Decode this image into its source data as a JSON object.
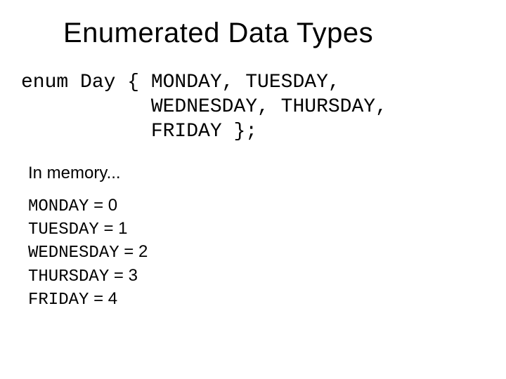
{
  "title": "Enumerated Data Types",
  "code": {
    "line1": "enum Day { MONDAY, TUESDAY,",
    "line2": "           WEDNESDAY, THURSDAY,",
    "line3": "           FRIDAY };"
  },
  "subhead": "In memory...",
  "mem": [
    {
      "name": "MONDAY",
      "eq": " = 0"
    },
    {
      "name": "TUESDAY",
      "eq": " = 1"
    },
    {
      "name": "WEDNESDAY",
      "eq": " = 2"
    },
    {
      "name": "THURSDAY",
      "eq": " = 3"
    },
    {
      "name": "FRIDAY",
      "eq": " = 4"
    }
  ]
}
